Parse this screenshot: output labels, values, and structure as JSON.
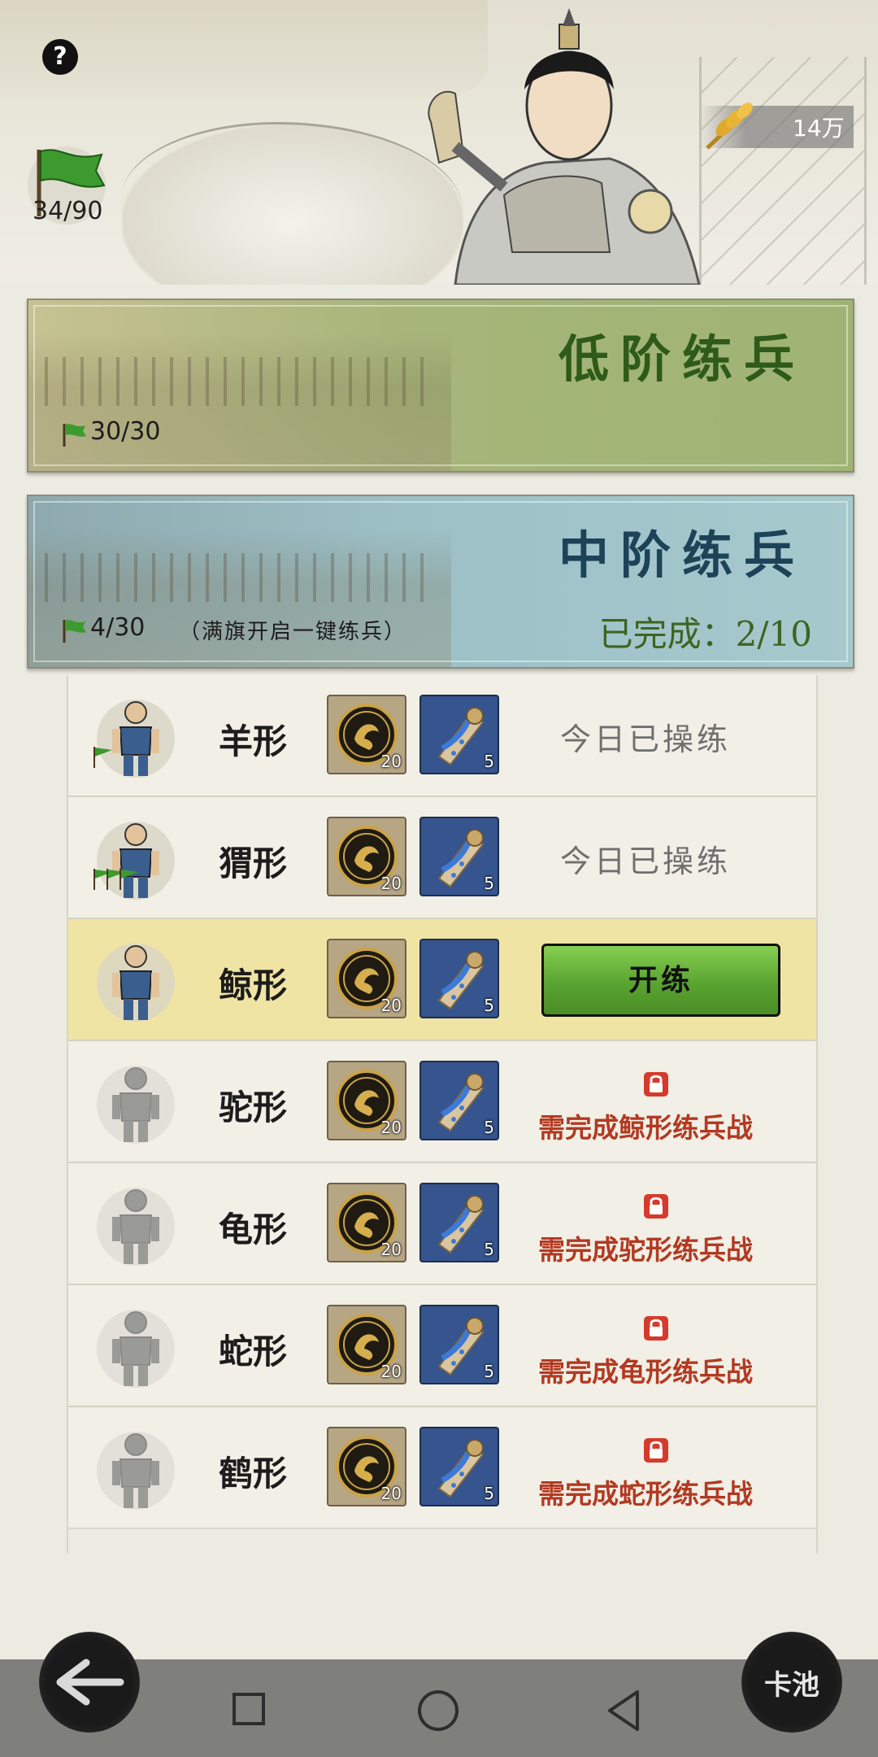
{
  "header": {
    "help_label": "?",
    "flag_count": "34/90",
    "grain_value": "14万"
  },
  "banners": [
    {
      "title": "低阶练兵",
      "flag_count": "30/30",
      "note": "",
      "progress": ""
    },
    {
      "title": "中阶练兵",
      "flag_count": "4/30",
      "note": "（满旗开启一键练兵）",
      "progress": "已完成：2/10"
    }
  ],
  "rows": [
    {
      "name": "羊形",
      "coin_count": "20",
      "scroll_count": "5",
      "state": "done",
      "status": "今日已操练",
      "flags": 1
    },
    {
      "name": "猬形",
      "coin_count": "20",
      "scroll_count": "5",
      "state": "done",
      "status": "今日已操练",
      "flags": 3
    },
    {
      "name": "鲸形",
      "coin_count": "20",
      "scroll_count": "5",
      "state": "active",
      "button": "开练",
      "flags": 0
    },
    {
      "name": "驼形",
      "coin_count": "20",
      "scroll_count": "5",
      "state": "locked",
      "requirement": "需完成鲸形练兵战",
      "flags": 0
    },
    {
      "name": "龟形",
      "coin_count": "20",
      "scroll_count": "5",
      "state": "locked",
      "requirement": "需完成驼形练兵战",
      "flags": 0
    },
    {
      "name": "蛇形",
      "coin_count": "20",
      "scroll_count": "5",
      "state": "locked",
      "requirement": "需完成龟形练兵战",
      "flags": 0
    },
    {
      "name": "鹤形",
      "coin_count": "20",
      "scroll_count": "5",
      "state": "locked",
      "requirement": "需完成蛇形练兵战",
      "flags": 0
    }
  ],
  "bottom": {
    "card_pool_label": "卡池"
  },
  "colors": {
    "active_row": "#f0e4a4",
    "button_green": "#5aa431",
    "lock_red": "#b23a22",
    "low_banner": "#a7b57a",
    "mid_banner": "#9cc0c6"
  }
}
